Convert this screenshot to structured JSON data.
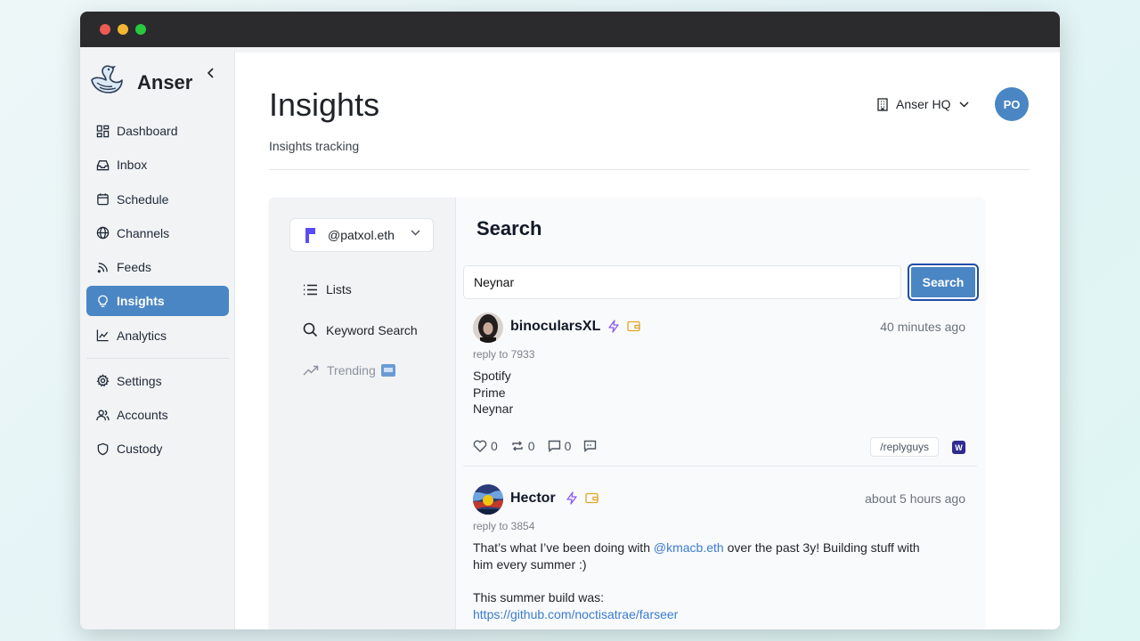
{
  "app": {
    "name": "Anser"
  },
  "sidebar": {
    "items": [
      {
        "label": "Dashboard",
        "icon": "dashboard-icon"
      },
      {
        "label": "Inbox",
        "icon": "inbox-icon"
      },
      {
        "label": "Schedule",
        "icon": "calendar-icon"
      },
      {
        "label": "Channels",
        "icon": "globe-icon"
      },
      {
        "label": "Feeds",
        "icon": "rss-icon"
      },
      {
        "label": "Insights",
        "icon": "lightbulb-icon",
        "active": true
      },
      {
        "label": "Analytics",
        "icon": "chart-icon"
      }
    ],
    "bottom_items": [
      {
        "label": "Settings",
        "icon": "gear-icon"
      },
      {
        "label": "Accounts",
        "icon": "users-icon"
      },
      {
        "label": "Custody",
        "icon": "shield-icon"
      }
    ]
  },
  "header": {
    "title": "Insights",
    "subtitle": "Insights tracking",
    "workspace": "Anser HQ",
    "avatar_initials": "PO"
  },
  "insights_nav": {
    "account": "@patxol.eth",
    "links": [
      {
        "label": "Lists",
        "icon": "list-icon"
      },
      {
        "label": "Keyword Search",
        "icon": "search-icon"
      },
      {
        "label": "Trending",
        "icon": "trending-icon",
        "badge": "new-badge-icon"
      }
    ]
  },
  "search": {
    "title": "Search",
    "query": "Neynar",
    "button_label": "Search"
  },
  "casts": [
    {
      "user": "binocularsXL",
      "time": "40 minutes ago",
      "reply_to": "reply to 7933",
      "lines": [
        "Spotify",
        "Prime",
        "Neynar"
      ],
      "likes": "0",
      "recasts": "0",
      "replies": "0",
      "channel": "/replyguys",
      "badge": "W"
    },
    {
      "user": "Hector",
      "time": "about 5 hours ago",
      "reply_to": "reply to 3854",
      "text_before": "That’s what I’ve been doing with ",
      "mention": "@kmacb.eth",
      "text_after": " over the past 3y! Building stuff with",
      "line2": "him every summer :)",
      "line3": "This summer build was:",
      "link": "https://github.com/noctisatrae/farseer"
    }
  ],
  "colors": {
    "accent": "#4a86c4",
    "mention": "#3b7bd1",
    "lightning": "#8b5cf6",
    "wallet": "#e0a526"
  }
}
